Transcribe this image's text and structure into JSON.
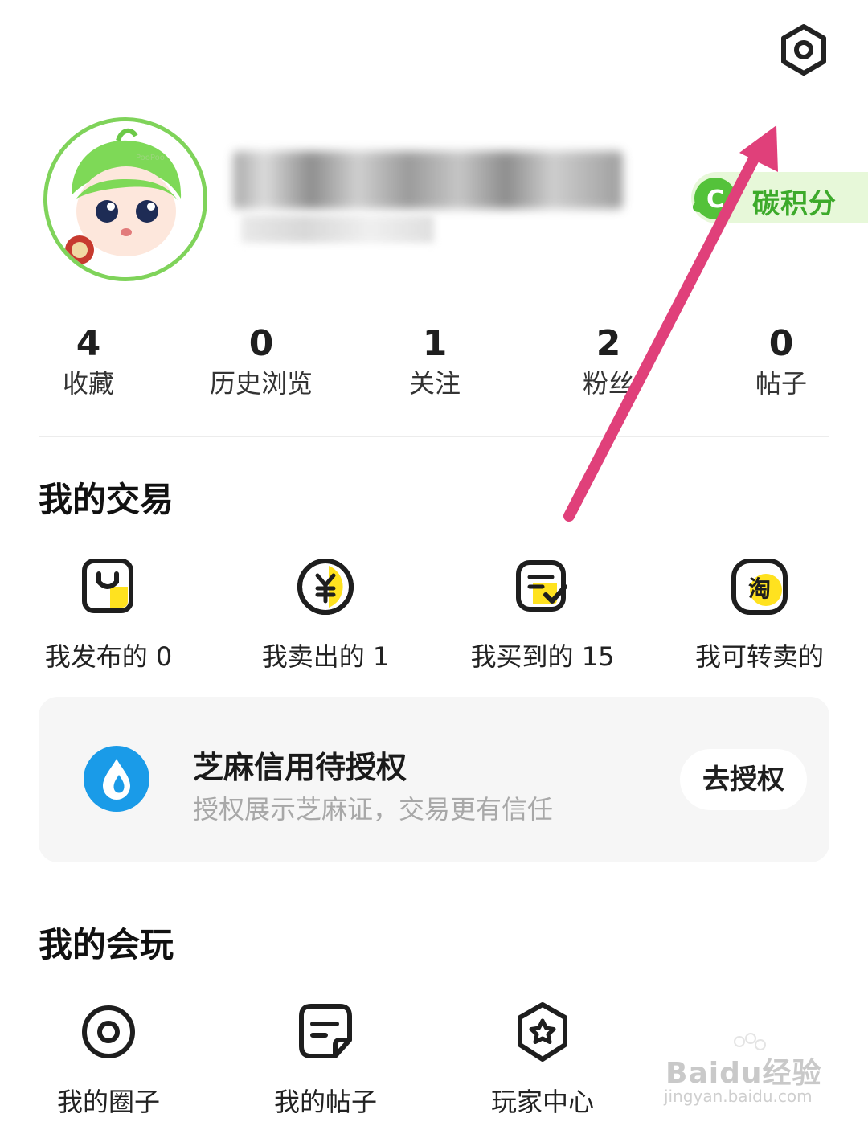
{
  "header": {
    "settings_icon": "settings-hexagon-icon"
  },
  "profile": {
    "avatar_icon": "cartoon-avatar",
    "carbon_badge": {
      "icon_letter": "C",
      "label": "碳积分"
    }
  },
  "stats": [
    {
      "value": "4",
      "label": "收藏"
    },
    {
      "value": "0",
      "label": "历史浏览"
    },
    {
      "value": "1",
      "label": "关注"
    },
    {
      "value": "2",
      "label": "粉丝"
    },
    {
      "value": "0",
      "label": "帖子"
    }
  ],
  "trade": {
    "title": "我的交易",
    "items": [
      {
        "label": "我发布的 0",
        "icon": "bag-icon"
      },
      {
        "label": "我卖出的 1",
        "icon": "yen-coin-icon"
      },
      {
        "label": "我买到的 15",
        "icon": "order-check-icon"
      },
      {
        "label": "我可转卖的",
        "icon": "taobao-icon",
        "icon_text": "淘"
      }
    ]
  },
  "zhima": {
    "title": "芝麻信用待授权",
    "subtitle": "授权展示芝麻证，交易更有信任",
    "button": "去授权",
    "accent": "#1a9be8"
  },
  "play": {
    "title": "我的会玩",
    "items": [
      {
        "label": "我的圈子",
        "icon": "circle-target-icon"
      },
      {
        "label": "我的帖子",
        "icon": "post-note-icon"
      },
      {
        "label": "玩家中心",
        "icon": "star-badge-icon"
      }
    ]
  },
  "colors": {
    "accent_yellow": "#ffe21f",
    "carbon_green": "#3daa2b",
    "arrow": "#e0407a"
  },
  "watermark": {
    "logo": "Baidu经验",
    "url": "jingyan.baidu.com"
  }
}
